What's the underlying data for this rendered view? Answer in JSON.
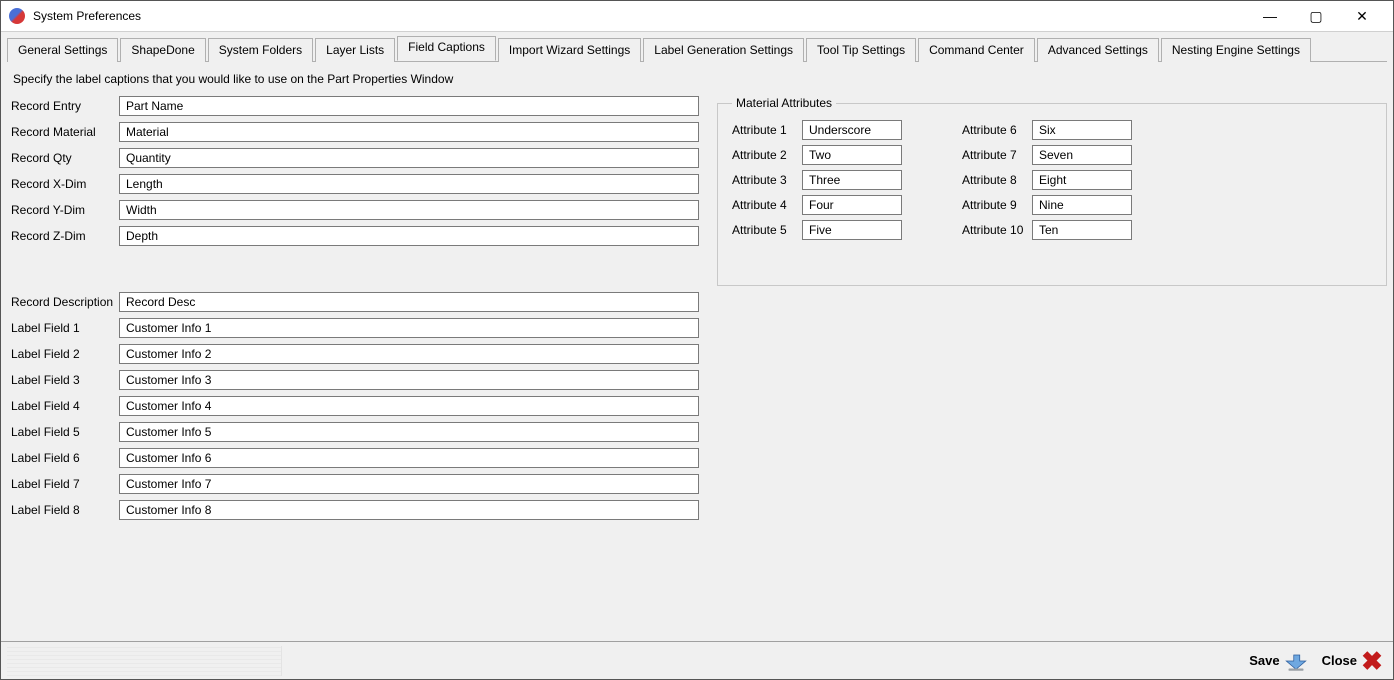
{
  "window": {
    "title": "System Preferences"
  },
  "tabs": [
    {
      "label": "General Settings"
    },
    {
      "label": "ShapeDone"
    },
    {
      "label": "System Folders"
    },
    {
      "label": "Layer Lists"
    },
    {
      "label": "Field Captions"
    },
    {
      "label": "Import Wizard Settings"
    },
    {
      "label": "Label Generation Settings"
    },
    {
      "label": "Tool Tip Settings"
    },
    {
      "label": "Command Center"
    },
    {
      "label": "Advanced Settings"
    },
    {
      "label": "Nesting Engine Settings"
    }
  ],
  "active_tab_index": 4,
  "instruction": "Specify the label captions that you would like to use on the Part Properties Window",
  "fields_top": [
    {
      "label": "Record Entry",
      "value": "Part Name"
    },
    {
      "label": "Record Material",
      "value": "Material"
    },
    {
      "label": "Record Qty",
      "value": "Quantity"
    },
    {
      "label": "Record X-Dim",
      "value": "Length"
    },
    {
      "label": "Record Y-Dim",
      "value": "Width"
    },
    {
      "label": "Record Z-Dim",
      "value": "Depth"
    }
  ],
  "fields_bottom": [
    {
      "label": "Record Description",
      "value": "Record Desc"
    },
    {
      "label": "Label Field 1",
      "value": "Customer Info 1"
    },
    {
      "label": "Label Field 2",
      "value": "Customer Info 2"
    },
    {
      "label": "Label Field 3",
      "value": "Customer Info 3"
    },
    {
      "label": "Label Field 4",
      "value": "Customer Info 4"
    },
    {
      "label": "Label Field 5",
      "value": "Customer Info 5"
    },
    {
      "label": "Label Field 6",
      "value": "Customer Info 6"
    },
    {
      "label": "Label Field 7",
      "value": "Customer Info 7"
    },
    {
      "label": "Label Field 8",
      "value": "Customer Info 8"
    }
  ],
  "material_attributes": {
    "legend": "Material Attributes",
    "left": [
      {
        "label": "Attribute 1",
        "value": "Underscore"
      },
      {
        "label": "Attribute 2",
        "value": "Two"
      },
      {
        "label": "Attribute 3",
        "value": "Three"
      },
      {
        "label": "Attribute 4",
        "value": "Four"
      },
      {
        "label": "Attribute 5",
        "value": "Five"
      }
    ],
    "right": [
      {
        "label": "Attribute 6",
        "value": "Six"
      },
      {
        "label": "Attribute 7",
        "value": "Seven"
      },
      {
        "label": "Attribute 8",
        "value": "Eight"
      },
      {
        "label": "Attribute 9",
        "value": "Nine"
      },
      {
        "label": "Attribute 10",
        "value": "Ten"
      }
    ]
  },
  "footer": {
    "save": "Save",
    "close": "Close"
  }
}
